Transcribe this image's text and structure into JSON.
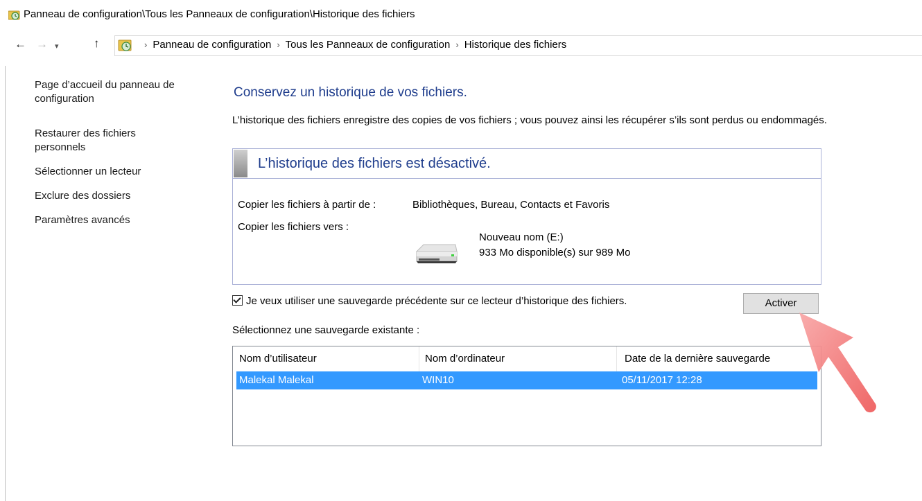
{
  "window": {
    "title": "Panneau de configuration\\Tous les Panneaux de configuration\\Historique des fichiers"
  },
  "address": {
    "crumbs": [
      "Panneau de configuration",
      "Tous les Panneaux de configuration",
      "Historique des fichiers"
    ]
  },
  "sidebar": {
    "items": [
      {
        "label": "Page d’accueil du panneau de configuration"
      },
      {
        "label": "Restaurer des fichiers personnels"
      },
      {
        "label": "Sélectionner un lecteur"
      },
      {
        "label": "Exclure des dossiers"
      },
      {
        "label": "Paramètres avancés"
      }
    ]
  },
  "main": {
    "heading": "Conservez un historique de vos fichiers.",
    "intro": "L’historique des fichiers enregistre des copies de vos fichiers ; vous pouvez ainsi les récupérer s’ils sont perdus ou endommagés.",
    "status_title": "L’historique des fichiers est désactivé.",
    "copy_from_label": "Copier les fichiers à partir de :",
    "copy_from_value": "Bibliothèques, Bureau, Contacts et Favoris",
    "copy_to_label": "Copier les fichiers vers :",
    "drive_name": "Nouveau nom (E:)",
    "drive_space": "933 Mo disponible(s) sur 989 Mo",
    "checkbox_label": "Je veux utiliser une sauvegarde précédente sur ce lecteur d’historique des fichiers.",
    "checkbox_checked": true,
    "activate_button": "Activer",
    "select_label": "Sélectionnez une sauvegarde existante :"
  },
  "backups": {
    "columns": [
      "Nom d’utilisateur",
      "Nom d’ordinateur",
      "Date de la dernière sauvegarde"
    ],
    "rows": [
      {
        "user": "Malekal Malekal",
        "computer": "WIN10",
        "date": "05/11/2017 12:28",
        "selected": true
      }
    ],
    "selection_color": "#3399ff"
  },
  "colors": {
    "heading": "#1e3c8c",
    "annotation_arrow": "#f06a6a"
  }
}
